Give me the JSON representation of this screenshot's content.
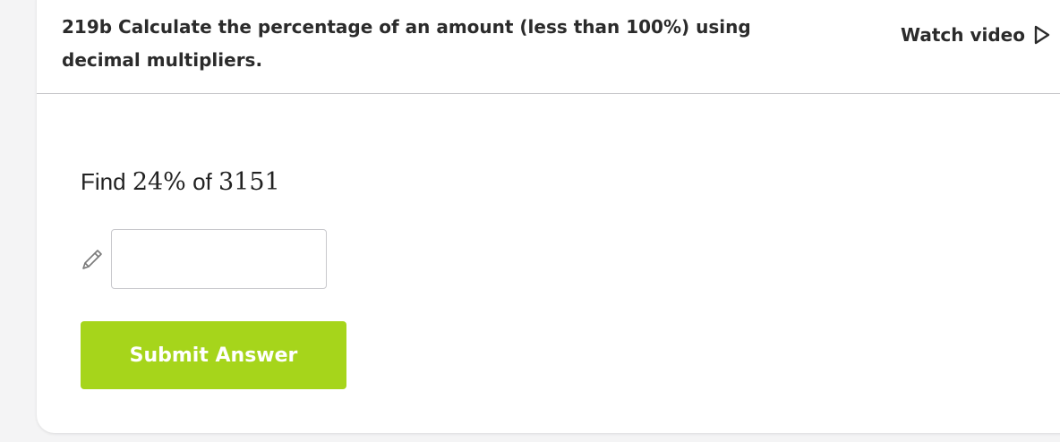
{
  "header": {
    "title": "219b Calculate the percentage of an amount (less than 100%) using decimal multipliers.",
    "watch_video_label": "Watch video",
    "watch_video_icon": "play-triangle-outline"
  },
  "question": {
    "prefix": "Find",
    "percent": "24%",
    "connector": "of",
    "amount": "3151"
  },
  "answer": {
    "value": "",
    "icon": "pencil-icon"
  },
  "submit": {
    "label": "Submit Answer",
    "color": "#a6d51b"
  }
}
